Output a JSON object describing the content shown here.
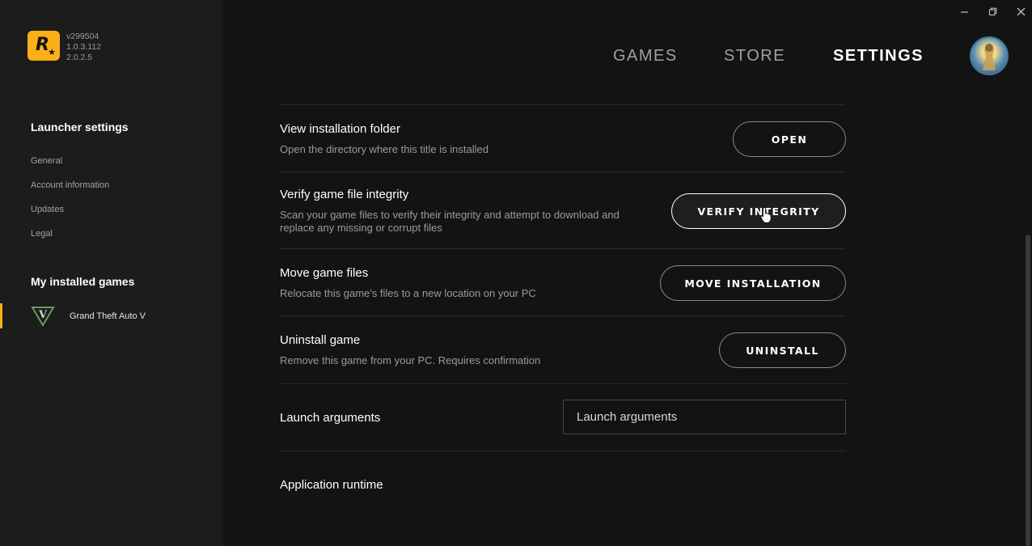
{
  "app": {
    "versions": [
      "v299504",
      "1.0.3.112",
      "2.0.2.5"
    ]
  },
  "sidebar": {
    "launcher_heading": "Launcher settings",
    "launcher_items": [
      "General",
      "Account information",
      "Updates",
      "Legal"
    ],
    "games_heading": "My installed games",
    "games": [
      "Grand Theft Auto V"
    ]
  },
  "nav": {
    "items": [
      "GAMES",
      "STORE",
      "SETTINGS"
    ],
    "active": "SETTINGS"
  },
  "settings": {
    "view_folder": {
      "title": "View installation folder",
      "desc": "Open the directory where this title is installed",
      "button": "OPEN"
    },
    "verify": {
      "title": "Verify game file integrity",
      "desc": "Scan your game files to verify their integrity and attempt to download and replace any missing or corrupt files",
      "button": "VERIFY INTEGRITY"
    },
    "move": {
      "title": "Move game files",
      "desc": "Relocate this game's files to a new location on your PC",
      "button": "MOVE INSTALLATION"
    },
    "uninstall": {
      "title": "Uninstall game",
      "desc": "Remove this game from your PC. Requires confirmation",
      "button": "UNINSTALL"
    },
    "launch_args": {
      "title": "Launch arguments",
      "placeholder": "Launch arguments"
    },
    "runtime": {
      "title": "Application runtime"
    }
  },
  "colors": {
    "accent": "#fcaf17",
    "background": "#131313",
    "sidebar": "#1c1c1c"
  }
}
